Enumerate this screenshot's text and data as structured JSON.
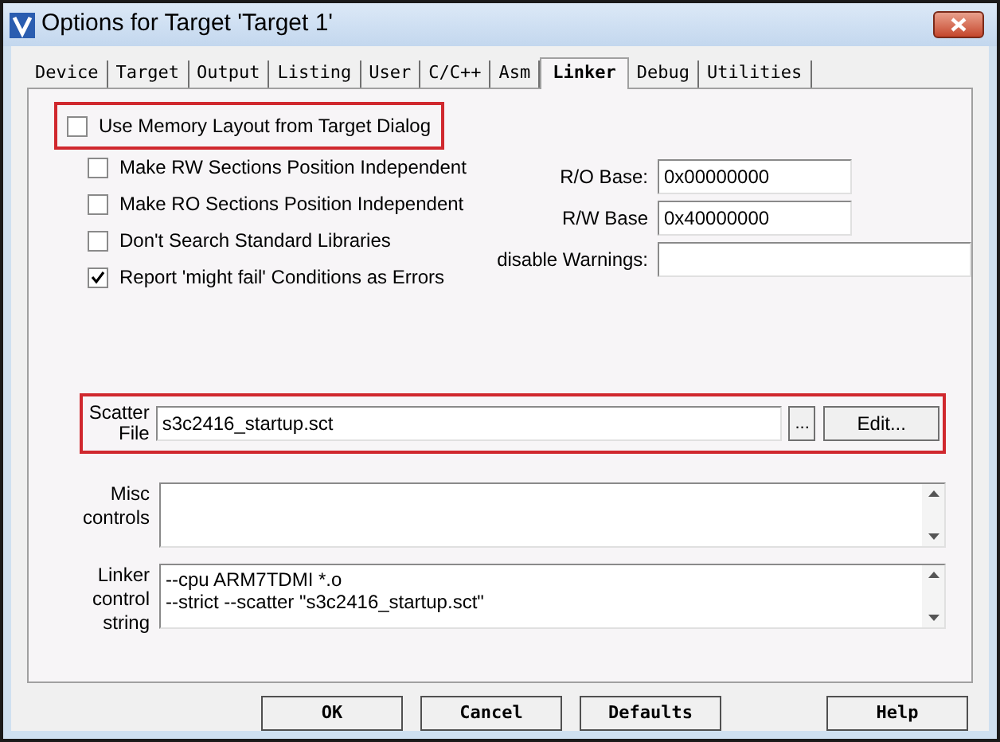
{
  "window": {
    "title": "Options for Target 'Target 1'"
  },
  "tabs": [
    {
      "label": "Device",
      "selected": false
    },
    {
      "label": "Target",
      "selected": false
    },
    {
      "label": "Output",
      "selected": false
    },
    {
      "label": "Listing",
      "selected": false
    },
    {
      "label": "User",
      "selected": false
    },
    {
      "label": "C/C++",
      "selected": false
    },
    {
      "label": "Asm",
      "selected": false
    },
    {
      "label": "Linker",
      "selected": true
    },
    {
      "label": "Debug",
      "selected": false
    },
    {
      "label": "Utilities",
      "selected": false
    }
  ],
  "memory_layout": {
    "label": "Use Memory Layout from Target Dialog",
    "checked": false,
    "highlighted": true
  },
  "options": [
    {
      "label": "Make RW Sections Position Independent",
      "checked": false
    },
    {
      "label": "Make RO Sections Position Independent",
      "checked": false
    },
    {
      "label": "Don't Search Standard Libraries",
      "checked": false
    },
    {
      "label": "Report 'might fail' Conditions as Errors",
      "checked": true
    }
  ],
  "bases": [
    {
      "label": "R/O Base:",
      "value": "0x00000000"
    },
    {
      "label": "R/W Base",
      "value": "0x40000000"
    },
    {
      "label": "disable Warnings:"
    }
  ],
  "scatter": {
    "label": "Scatter File",
    "value": "s3c2416_startup.sct",
    "browse": "...",
    "edit": "Edit...",
    "highlighted": true
  },
  "misc": {
    "label": "Misc controls"
  },
  "linker": {
    "label": "Linker control string",
    "lines": [
      "--cpu ARM7TDMI *.o",
      "--strict --scatter \"s3c2416_startup.sct\""
    ]
  },
  "buttons": [
    "OK",
    "Cancel",
    "Defaults",
    "Help"
  ]
}
